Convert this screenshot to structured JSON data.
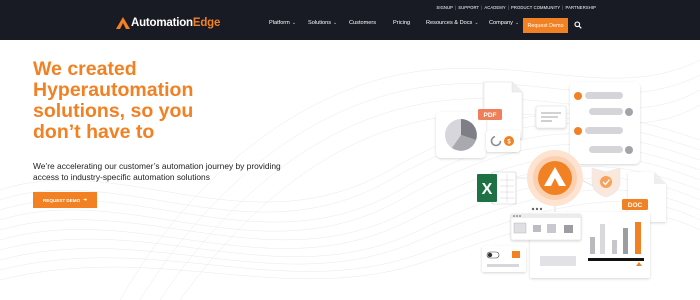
{
  "topbar": {
    "links": [
      "SIGNUP",
      "SUPPORT",
      "ACADEMY",
      "PRODUCT COMMUNITY",
      "PARTNERSHIP"
    ]
  },
  "brand": {
    "name_part1": "Automation",
    "name_part2": "Edge"
  },
  "nav": {
    "items": [
      {
        "label": "Platform",
        "dropdown": true
      },
      {
        "label": "Solutions",
        "dropdown": true
      },
      {
        "label": "Customers",
        "dropdown": false
      },
      {
        "label": "Pricing",
        "dropdown": false
      },
      {
        "label": "Resources & Docs",
        "dropdown": true
      },
      {
        "label": "Company",
        "dropdown": true
      }
    ],
    "cta_label": "Request Demo",
    "search_icon": "search-icon"
  },
  "hero": {
    "headline": "We created\nHyperautomation\nsolutions, so you\ndon’t have to",
    "subline": "We’re accelerating our customer’s automation journey by providing access to industry-specific automation solutions",
    "cta_label": "REQUEST DEMO",
    "cta_icon": "arrow-right-icon"
  },
  "illustration": {
    "pdf_label": "PDF",
    "doc_label": "DOC",
    "coin_label": "$"
  },
  "colors": {
    "accent": "#f28124",
    "header_bg": "#191b24",
    "excel": "#1e7145"
  }
}
